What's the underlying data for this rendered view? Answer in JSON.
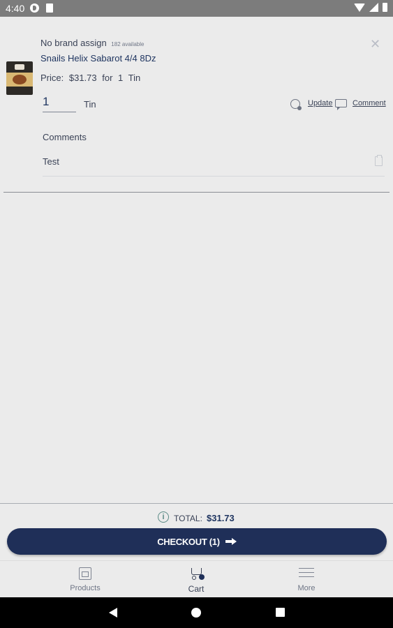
{
  "status_bar": {
    "time": "4:40"
  },
  "cart_item": {
    "brand": "No brand assign",
    "availability": "182 available",
    "title": "Snails Helix Sabarot 4/4 8Dz",
    "price_label": "Price:",
    "price_value": "$31.73",
    "price_for": "for",
    "price_qty": "1",
    "price_unit": "Tin",
    "quantity": "1",
    "unit": "Tin",
    "update_label": "Update",
    "comment_label": "Comment",
    "comments_heading": "Comments",
    "comment_text": "Test"
  },
  "summary": {
    "total_label": "TOTAL:",
    "total_value": "$31.73",
    "checkout_label": "CHECKOUT (1)"
  },
  "bottom_nav": {
    "items": [
      {
        "label": "Products",
        "icon": "products-icon"
      },
      {
        "label": "Cart",
        "icon": "cart-icon",
        "active": true
      },
      {
        "label": "More",
        "icon": "menu-icon"
      }
    ]
  },
  "colors": {
    "primary": "#1f2f58",
    "background": "#ebebeb",
    "status_bar": "#7c7c7c"
  }
}
